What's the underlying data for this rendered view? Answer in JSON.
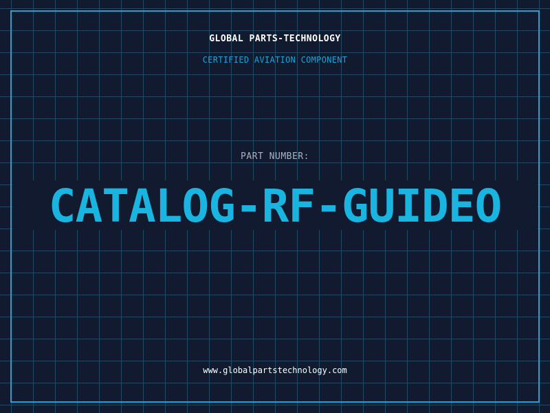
{
  "header": {
    "company": "GLOBAL PARTS-TECHNOLOGY",
    "subtitle": "CERTIFIED AVIATION COMPONENT"
  },
  "part": {
    "label": "PART NUMBER:",
    "number": "CATALOG-RF-GUIDEO"
  },
  "footer": {
    "website": "www.globalpartstechnology.com"
  },
  "colors": {
    "background": "#111a2e",
    "grid": "#1f4a63",
    "accent": "#19b4e0",
    "frame": "#1aa3d6"
  }
}
